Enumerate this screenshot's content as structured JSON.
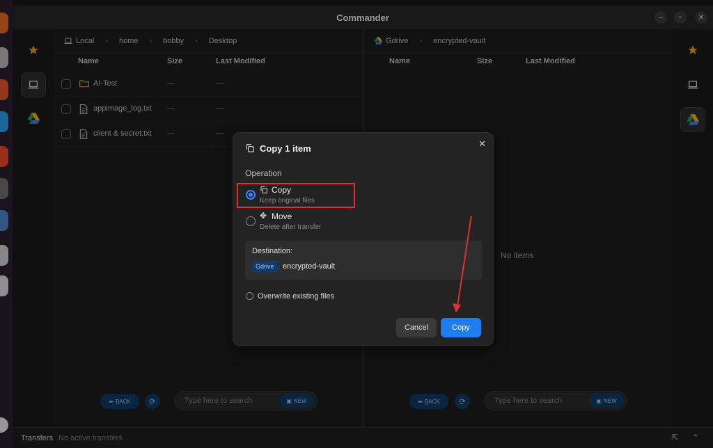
{
  "window": {
    "title": "Commander"
  },
  "colors": {
    "accent": "#1f7df0",
    "highlight": "#e0312a",
    "star": "#e0a020",
    "folder": "#d6a23a"
  },
  "left_pane": {
    "breadcrumb": [
      "Local",
      "home",
      "bobby",
      "Desktop"
    ],
    "columns": {
      "name": "Name",
      "size": "Size",
      "modified": "Last Modified"
    },
    "rows": [
      {
        "name": "AI-Test",
        "type": "folder",
        "size": "—",
        "modified": "—"
      },
      {
        "name": "appimage_log.txt",
        "type": "file",
        "size": "—",
        "modified": "—"
      },
      {
        "name": "client & secret.txt",
        "type": "file",
        "size": "—",
        "modified": "—"
      }
    ],
    "back_label": "BACK",
    "search_placeholder": "Type here to search",
    "new_label": "NEW"
  },
  "right_pane": {
    "breadcrumb": [
      "Gdrive",
      "encrypted-vault"
    ],
    "columns": {
      "name": "Name",
      "size": "Size",
      "modified": "Last Modified"
    },
    "empty_text": "No items",
    "back_label": "BACK",
    "search_placeholder": "Type here to search",
    "new_label": "NEW"
  },
  "dialog": {
    "title": "Copy 1 item",
    "operation_label": "Operation",
    "options": [
      {
        "title": "Copy",
        "subtitle": "Keep original files",
        "selected": true
      },
      {
        "title": "Move",
        "subtitle": "Delete after transfer",
        "selected": false
      }
    ],
    "destination_label": "Destination:",
    "destination_tag": "Gdrive",
    "destination_value": "encrypted-vault",
    "overwrite_label": "Overwrite existing files",
    "overwrite_checked": false,
    "cancel_label": "Cancel",
    "confirm_label": "Copy"
  },
  "transfers": {
    "label": "Transfers",
    "status": "No active transfers"
  }
}
